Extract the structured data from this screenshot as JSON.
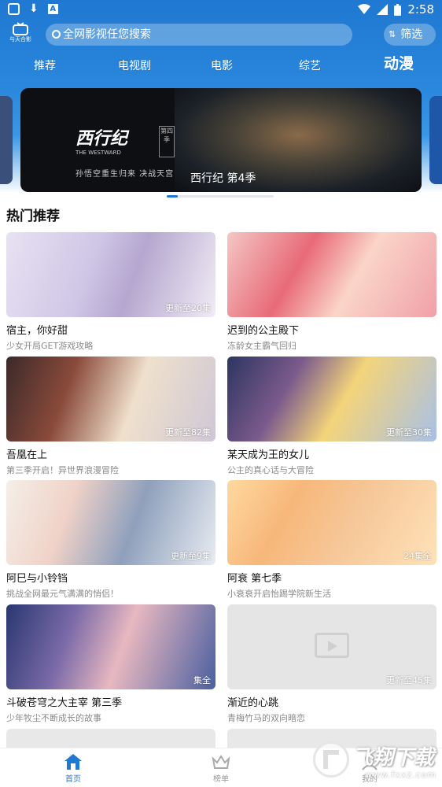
{
  "status_bar": {
    "time": "2:58",
    "left_icons": [
      "app-square-icon",
      "download-icon",
      "text-a-icon"
    ],
    "right_icons": [
      "wifi-icon",
      "signal-icon",
      "battery-icon"
    ]
  },
  "app": {
    "logo_text": "与天合影"
  },
  "search": {
    "placeholder": "全网影视任您搜索"
  },
  "filter": {
    "label": "筛选"
  },
  "tabs": [
    {
      "label": "推荐",
      "active": false
    },
    {
      "label": "电视剧",
      "active": false
    },
    {
      "label": "电影",
      "active": false
    },
    {
      "label": "综艺",
      "active": false
    },
    {
      "label": "动漫",
      "active": true
    }
  ],
  "banner": {
    "logo_text": "西行纪",
    "logo_sub": "THE WESTWARD",
    "season_tag": "第四季",
    "tagline": "孙悟空重生归来 决战天宫",
    "caption": "西行纪 第4季"
  },
  "section": {
    "title": "热门推荐"
  },
  "cards": [
    {
      "title": "宿主，你好甜",
      "subtitle": "少女开局GET游戏攻略",
      "badge": "更新至20集"
    },
    {
      "title": "迟到的公主殿下",
      "subtitle": "冻龄女主霸气回归",
      "badge": ""
    },
    {
      "title": "吾凰在上",
      "subtitle": "第三季开启！异世界浪漫冒险",
      "badge": "更新至82集"
    },
    {
      "title": "某天成为王的女儿",
      "subtitle": "公主的真心话与大冒险",
      "badge": "更新至30集"
    },
    {
      "title": "阿巳与小铃铛",
      "subtitle": "挑战全网最元气满满的悄侣！",
      "badge": "更新至9集"
    },
    {
      "title": "阿衰 第七季",
      "subtitle": "小衰衰开启怡踢学院新生活",
      "badge": "24集全"
    },
    {
      "title": "斗破苍穹之大主宰 第三季",
      "subtitle": "少年牧尘不断成长的故事",
      "badge": "集全"
    },
    {
      "title": "渐近的心跳",
      "subtitle": "青梅竹马的双向暗恋",
      "badge": "更新至45集"
    }
  ],
  "bottom_nav": [
    {
      "label": "首页",
      "icon": "home-icon",
      "active": true
    },
    {
      "label": "榜单",
      "icon": "crown-icon",
      "active": false
    },
    {
      "label": "我的",
      "icon": "profile-icon",
      "active": false
    }
  ],
  "watermark": {
    "title": "飞翔下载",
    "url": "www.fxxz.com"
  },
  "colors": {
    "primary": "#1f78d1",
    "header_bottom": "#3a97e4",
    "muted_text": "#8a8a8a"
  }
}
